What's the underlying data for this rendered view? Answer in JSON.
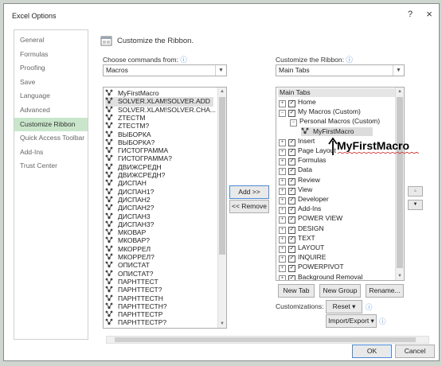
{
  "window": {
    "title": "Excel Options",
    "help": "?",
    "close": "×"
  },
  "nav": [
    "General",
    "Formulas",
    "Proofing",
    "Save",
    "Language",
    "Advanced",
    "Customize Ribbon",
    "Quick Access Toolbar",
    "Add-Ins",
    "Trust Center"
  ],
  "nav_selected": 6,
  "header": {
    "title": "Customize the Ribbon."
  },
  "left": {
    "label": "Choose commands from:",
    "value": "Macros",
    "items": [
      "MyFirstMacro",
      "SOLVER.XLAM!SOLVER.ADD",
      "SOLVER.XLAM!SOLVER.CHA...",
      "ZTECTM",
      "ZTECTM?",
      "ВЫБОРКА",
      "ВЫБОРКА?",
      "ГИСТОГРАММА",
      "ГИСТОГРАММА?",
      "ДВИЖСРЕДН",
      "ДВИЖСРЕДН?",
      "ДИСПАН",
      "ДИСПАН1?",
      "ДИСПАН2",
      "ДИСПАН2?",
      "ДИСПАН3",
      "ДИСПАН3?",
      "МКОВАР",
      "МКОВАР?",
      "МКОРРЕЛ",
      "МКОРРЕЛ?",
      "ОПИСТАТ",
      "ОПИСТАТ?",
      "ПАРНТТЕСТ",
      "ПАРНТТЕСТ?",
      "ПАРНТТЕСТН",
      "ПАРНТТЕСТН?",
      "ПАРНТТЕСТР",
      "ПАРНТТЕСТР?"
    ]
  },
  "middle": {
    "add": "Add >>",
    "remove": "<< Remove"
  },
  "right": {
    "label": "Customize the Ribbon:",
    "value": "Main Tabs",
    "tree_header": "Main Tabs",
    "tree": [
      {
        "text": "Home",
        "level": 0,
        "exp": "+",
        "chk": true
      },
      {
        "text": "My Macros (Custom)",
        "level": 0,
        "exp": "−",
        "chk": true
      },
      {
        "text": "Personal Macros (Custom)",
        "level": 1,
        "exp": "−",
        "chk": null
      },
      {
        "text": "MyFirstMacro",
        "level": 2,
        "exp": null,
        "chk": null,
        "icon": true,
        "hl": true
      },
      {
        "text": "Insert",
        "level": 0,
        "exp": "+",
        "chk": true
      },
      {
        "text": "Page Layout",
        "level": 0,
        "exp": "+",
        "chk": true
      },
      {
        "text": "Formulas",
        "level": 0,
        "exp": "+",
        "chk": true
      },
      {
        "text": "Data",
        "level": 0,
        "exp": "+",
        "chk": true
      },
      {
        "text": "Review",
        "level": 0,
        "exp": "+",
        "chk": true
      },
      {
        "text": "View",
        "level": 0,
        "exp": "+",
        "chk": true
      },
      {
        "text": "Developer",
        "level": 0,
        "exp": "+",
        "chk": true
      },
      {
        "text": "Add-Ins",
        "level": 0,
        "exp": "+",
        "chk": true
      },
      {
        "text": "POWER VIEW",
        "level": 0,
        "exp": "+",
        "chk": true
      },
      {
        "text": "DESIGN",
        "level": 0,
        "exp": "+",
        "chk": true
      },
      {
        "text": "TEXT",
        "level": 0,
        "exp": "+",
        "chk": true
      },
      {
        "text": "LAYOUT",
        "level": 0,
        "exp": "+",
        "chk": true
      },
      {
        "text": "INQUIRE",
        "level": 0,
        "exp": "+",
        "chk": true
      },
      {
        "text": "POWERPIVOT",
        "level": 0,
        "exp": "+",
        "chk": true
      },
      {
        "text": "Background Removal",
        "level": 0,
        "exp": "+",
        "chk": true
      }
    ],
    "buttons": {
      "new_tab": "New Tab",
      "new_group": "New Group",
      "rename": "Rename..."
    },
    "customizations_label": "Customizations:",
    "reset": "Reset ▾",
    "import_export": "Import/Export ▾"
  },
  "annotation": "MyFirstMacro",
  "footer": {
    "ok": "OK",
    "cancel": "Cancel"
  },
  "colors": {
    "nav_selected": "#c9e6cb",
    "annotation": "#000000",
    "default_button_border": "#4a8ad8"
  }
}
